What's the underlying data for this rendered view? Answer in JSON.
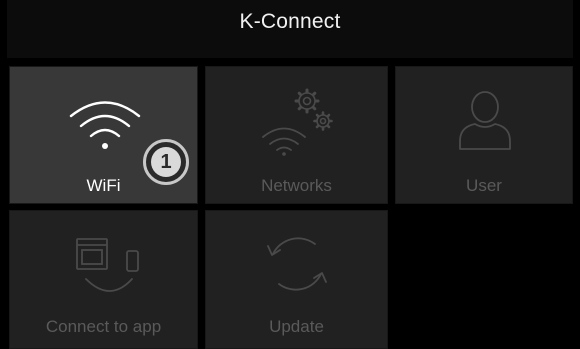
{
  "app": {
    "title": "K-Connect"
  },
  "tiles": [
    {
      "label": "WiFi",
      "icon": "wifi-icon",
      "state": "active"
    },
    {
      "label": "Networks",
      "icon": "network-settings-icon",
      "state": "disabled"
    },
    {
      "label": "User",
      "icon": "user-icon",
      "state": "disabled"
    },
    {
      "label": "Connect to app",
      "icon": "oven-phone-icon",
      "state": "disabled"
    },
    {
      "label": "Update",
      "icon": "refresh-icon",
      "state": "disabled"
    }
  ],
  "badge": {
    "value": "1",
    "icon": "step-number-badge"
  },
  "colors": {
    "background": "#000000",
    "tile": "#212121",
    "tile_active": "#383838",
    "text_active": "#ffffff",
    "text_disabled": "#5a5a5a",
    "icon_disabled": "#4a4a4a"
  }
}
